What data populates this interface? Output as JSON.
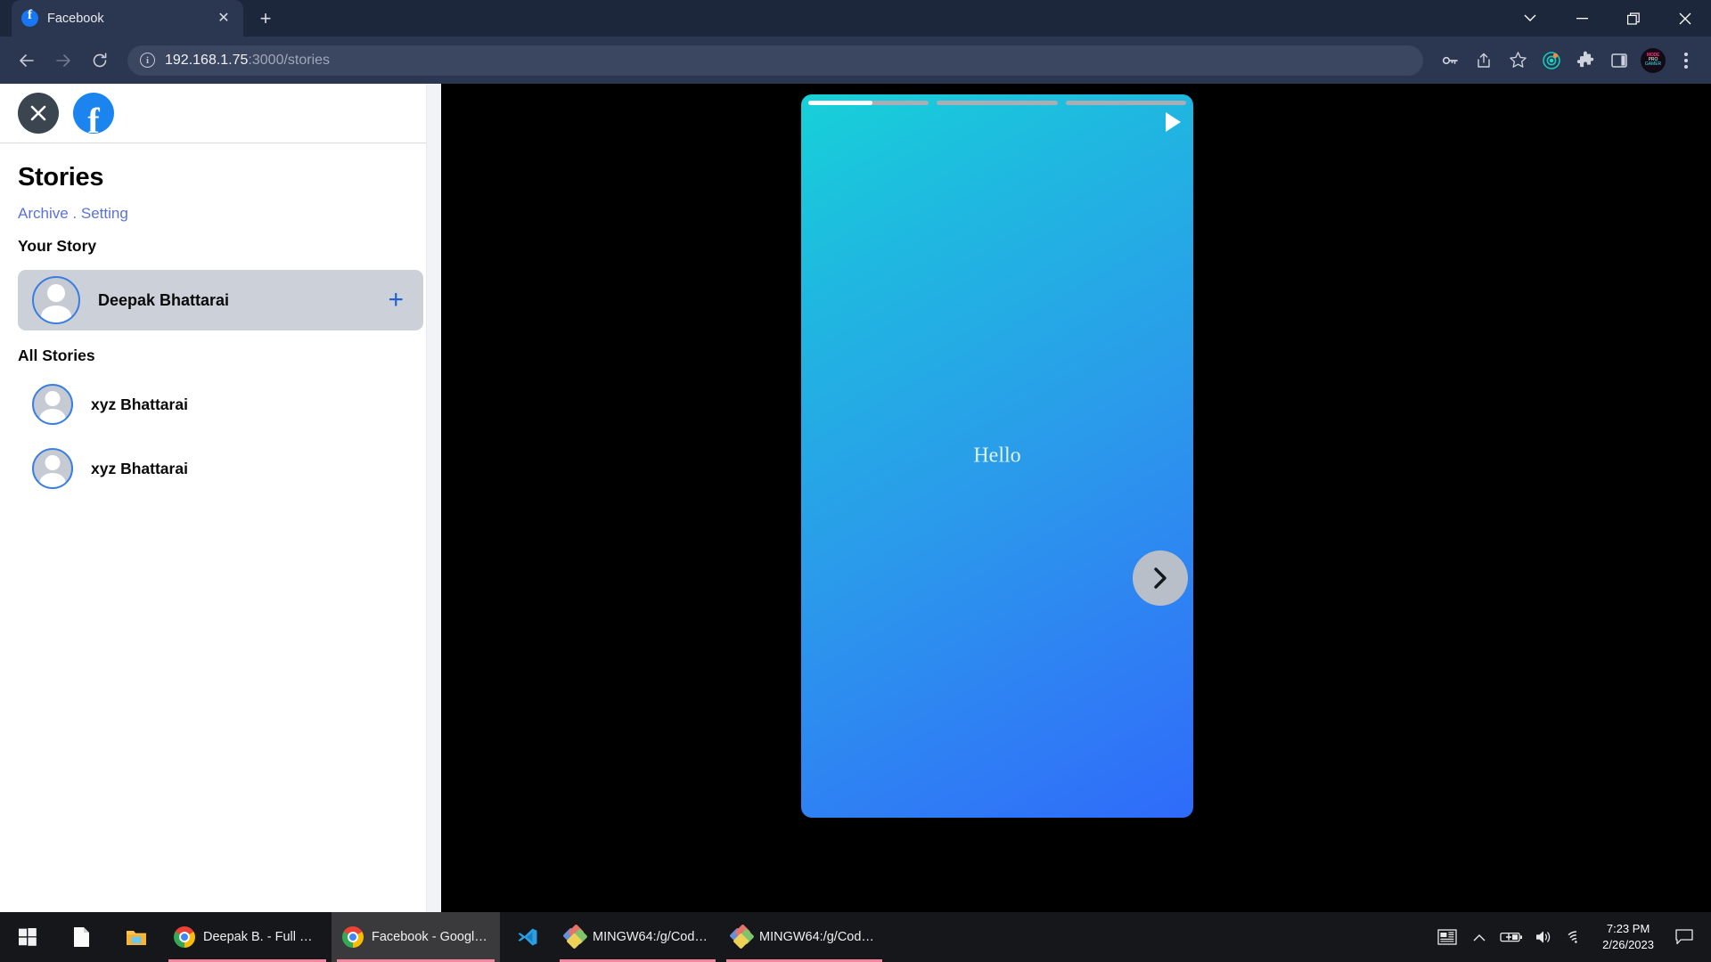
{
  "browser": {
    "tab": {
      "title": "Facebook",
      "favicon": "facebook-favicon",
      "close_label": "✕"
    },
    "new_tab_label": "+",
    "window_controls": {
      "tab_search": "tab-search-chevron",
      "minimize": "minimize",
      "restore": "restore",
      "close": "close"
    },
    "nav": {
      "back": "back-arrow",
      "forward": "forward-arrow",
      "reload": "reload"
    },
    "omnibox": {
      "info_glyph": "ⓘ",
      "url_host": "192.168.1.75",
      "url_path": ":3000/stories",
      "full_url": "192.168.1.75:3000/stories"
    },
    "toolbar_icons": [
      "password-key-icon",
      "share-icon",
      "bookmark-star-icon",
      "target-extension-icon",
      "extensions-puzzle-icon",
      "side-panel-icon",
      "profile-avatar-icon"
    ],
    "profile_badge": {
      "line1": "MODE",
      "line2": "PRO",
      "line3": "GAMER"
    },
    "menu": "chrome-menu-dots"
  },
  "sidebar": {
    "close_button_label": "✕",
    "brand_icon": "facebook-logo",
    "brand_letter": "f",
    "title": "Stories",
    "links": {
      "archive": "Archive",
      "separator": " . ",
      "setting": "Setting"
    },
    "your_story_heading": "Your Story",
    "your_story": {
      "name": "Deepak Bhattarai",
      "add_label": "+"
    },
    "all_stories_heading": "All Stories",
    "all_stories": [
      {
        "name": "xyz Bhattarai"
      },
      {
        "name": "xyz Bhattarai"
      }
    ]
  },
  "viewer": {
    "story_text": "Hello",
    "progress": [
      {
        "filled_percent": 53
      },
      {
        "filled_percent": 0
      },
      {
        "filled_percent": 0
      }
    ],
    "play_button": "play-icon",
    "next_button": "next-chevron-icon",
    "gradient_from": "#17d1d8",
    "gradient_to": "#2f6bfa",
    "background": "#000000"
  },
  "taskbar": {
    "start": "windows-start-icon",
    "items": [
      {
        "icon": "notepad-icon",
        "label": "",
        "active": false,
        "square": true,
        "underline": false
      },
      {
        "icon": "file-explorer-icon",
        "label": "",
        "active": false,
        "square": true,
        "underline": false
      },
      {
        "icon": "chrome-icon",
        "label": "Deepak B. - Full Sta...",
        "active": false,
        "square": false,
        "underline": true
      },
      {
        "icon": "chrome-icon",
        "label": "Facebook - Google ...",
        "active": true,
        "square": false,
        "underline": true
      },
      {
        "icon": "vscode-icon",
        "label": "",
        "active": false,
        "square": true,
        "underline": false
      },
      {
        "icon": "gitbash-icon",
        "label": "MINGW64:/g/Codin...",
        "active": false,
        "square": false,
        "underline": true
      },
      {
        "icon": "gitbash-icon",
        "label": "MINGW64:/g/Codin...",
        "active": false,
        "square": false,
        "underline": true
      }
    ],
    "tray": [
      "news-weather-icon",
      "show-hidden-icons-chevron",
      "battery-charging-icon",
      "volume-icon",
      "wifi-icon"
    ],
    "clock": {
      "time": "7:23 PM",
      "date": "2/26/2023"
    },
    "notifications": "notification-bubble-icon"
  }
}
